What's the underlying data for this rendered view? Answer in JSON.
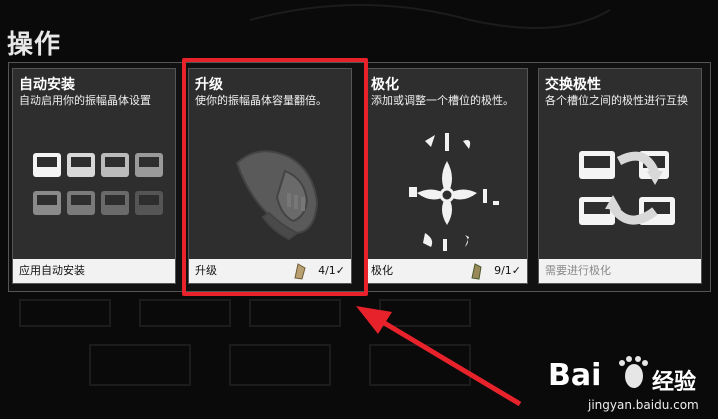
{
  "title": "操作",
  "cards": [
    {
      "title": "自动安装",
      "desc": "自动启用你的振幅晶体设置",
      "footer": "应用自动安装",
      "count": "",
      "check": ""
    },
    {
      "title": "升级",
      "desc": "使你的振幅晶体容量翻倍。",
      "footer": "升级",
      "count": "4/1",
      "check": "✓"
    },
    {
      "title": "极化",
      "desc": "添加或调整一个槽位的极性。",
      "footer": "极化",
      "count": "9/1",
      "check": "✓"
    },
    {
      "title": "交换极性",
      "desc": "各个槽位之间的极性进行互换",
      "footer": "需要进行极化",
      "count": "",
      "check": ""
    }
  ],
  "watermark": {
    "brand_a": "Bai",
    "brand_b": "经验",
    "url": "jingyan.baidu.com"
  },
  "colors": {
    "highlight": "#e8222a",
    "card_bg": "#2e2e2e",
    "footer_bg": "#f2f2f2"
  },
  "icons": {
    "upgrade_art": "gear-coupling-icon",
    "polarize_art": "polarity-symbols-icon",
    "swap_art": "swap-arrows-icon",
    "count_icon": "crystal-item-icon"
  }
}
